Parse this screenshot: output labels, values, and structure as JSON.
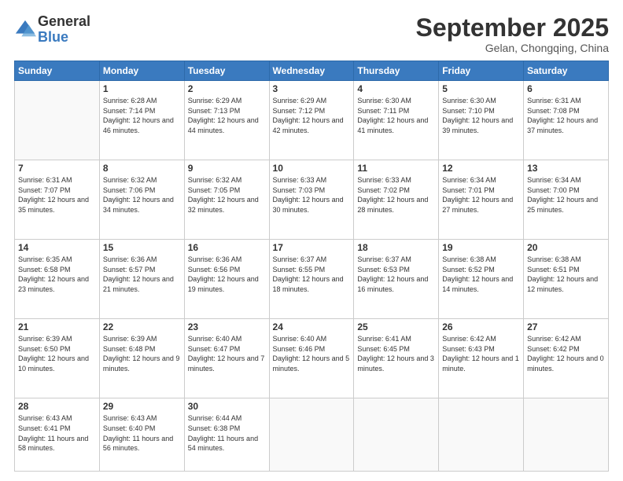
{
  "logo": {
    "general": "General",
    "blue": "Blue"
  },
  "header": {
    "month": "September 2025",
    "location": "Gelan, Chongqing, China"
  },
  "weekdays": [
    "Sunday",
    "Monday",
    "Tuesday",
    "Wednesday",
    "Thursday",
    "Friday",
    "Saturday"
  ],
  "weeks": [
    [
      {
        "day": "",
        "sunrise": "",
        "sunset": "",
        "daylight": ""
      },
      {
        "day": "1",
        "sunrise": "Sunrise: 6:28 AM",
        "sunset": "Sunset: 7:14 PM",
        "daylight": "Daylight: 12 hours and 46 minutes."
      },
      {
        "day": "2",
        "sunrise": "Sunrise: 6:29 AM",
        "sunset": "Sunset: 7:13 PM",
        "daylight": "Daylight: 12 hours and 44 minutes."
      },
      {
        "day": "3",
        "sunrise": "Sunrise: 6:29 AM",
        "sunset": "Sunset: 7:12 PM",
        "daylight": "Daylight: 12 hours and 42 minutes."
      },
      {
        "day": "4",
        "sunrise": "Sunrise: 6:30 AM",
        "sunset": "Sunset: 7:11 PM",
        "daylight": "Daylight: 12 hours and 41 minutes."
      },
      {
        "day": "5",
        "sunrise": "Sunrise: 6:30 AM",
        "sunset": "Sunset: 7:10 PM",
        "daylight": "Daylight: 12 hours and 39 minutes."
      },
      {
        "day": "6",
        "sunrise": "Sunrise: 6:31 AM",
        "sunset": "Sunset: 7:08 PM",
        "daylight": "Daylight: 12 hours and 37 minutes."
      }
    ],
    [
      {
        "day": "7",
        "sunrise": "Sunrise: 6:31 AM",
        "sunset": "Sunset: 7:07 PM",
        "daylight": "Daylight: 12 hours and 35 minutes."
      },
      {
        "day": "8",
        "sunrise": "Sunrise: 6:32 AM",
        "sunset": "Sunset: 7:06 PM",
        "daylight": "Daylight: 12 hours and 34 minutes."
      },
      {
        "day": "9",
        "sunrise": "Sunrise: 6:32 AM",
        "sunset": "Sunset: 7:05 PM",
        "daylight": "Daylight: 12 hours and 32 minutes."
      },
      {
        "day": "10",
        "sunrise": "Sunrise: 6:33 AM",
        "sunset": "Sunset: 7:03 PM",
        "daylight": "Daylight: 12 hours and 30 minutes."
      },
      {
        "day": "11",
        "sunrise": "Sunrise: 6:33 AM",
        "sunset": "Sunset: 7:02 PM",
        "daylight": "Daylight: 12 hours and 28 minutes."
      },
      {
        "day": "12",
        "sunrise": "Sunrise: 6:34 AM",
        "sunset": "Sunset: 7:01 PM",
        "daylight": "Daylight: 12 hours and 27 minutes."
      },
      {
        "day": "13",
        "sunrise": "Sunrise: 6:34 AM",
        "sunset": "Sunset: 7:00 PM",
        "daylight": "Daylight: 12 hours and 25 minutes."
      }
    ],
    [
      {
        "day": "14",
        "sunrise": "Sunrise: 6:35 AM",
        "sunset": "Sunset: 6:58 PM",
        "daylight": "Daylight: 12 hours and 23 minutes."
      },
      {
        "day": "15",
        "sunrise": "Sunrise: 6:36 AM",
        "sunset": "Sunset: 6:57 PM",
        "daylight": "Daylight: 12 hours and 21 minutes."
      },
      {
        "day": "16",
        "sunrise": "Sunrise: 6:36 AM",
        "sunset": "Sunset: 6:56 PM",
        "daylight": "Daylight: 12 hours and 19 minutes."
      },
      {
        "day": "17",
        "sunrise": "Sunrise: 6:37 AM",
        "sunset": "Sunset: 6:55 PM",
        "daylight": "Daylight: 12 hours and 18 minutes."
      },
      {
        "day": "18",
        "sunrise": "Sunrise: 6:37 AM",
        "sunset": "Sunset: 6:53 PM",
        "daylight": "Daylight: 12 hours and 16 minutes."
      },
      {
        "day": "19",
        "sunrise": "Sunrise: 6:38 AM",
        "sunset": "Sunset: 6:52 PM",
        "daylight": "Daylight: 12 hours and 14 minutes."
      },
      {
        "day": "20",
        "sunrise": "Sunrise: 6:38 AM",
        "sunset": "Sunset: 6:51 PM",
        "daylight": "Daylight: 12 hours and 12 minutes."
      }
    ],
    [
      {
        "day": "21",
        "sunrise": "Sunrise: 6:39 AM",
        "sunset": "Sunset: 6:50 PM",
        "daylight": "Daylight: 12 hours and 10 minutes."
      },
      {
        "day": "22",
        "sunrise": "Sunrise: 6:39 AM",
        "sunset": "Sunset: 6:48 PM",
        "daylight": "Daylight: 12 hours and 9 minutes."
      },
      {
        "day": "23",
        "sunrise": "Sunrise: 6:40 AM",
        "sunset": "Sunset: 6:47 PM",
        "daylight": "Daylight: 12 hours and 7 minutes."
      },
      {
        "day": "24",
        "sunrise": "Sunrise: 6:40 AM",
        "sunset": "Sunset: 6:46 PM",
        "daylight": "Daylight: 12 hours and 5 minutes."
      },
      {
        "day": "25",
        "sunrise": "Sunrise: 6:41 AM",
        "sunset": "Sunset: 6:45 PM",
        "daylight": "Daylight: 12 hours and 3 minutes."
      },
      {
        "day": "26",
        "sunrise": "Sunrise: 6:42 AM",
        "sunset": "Sunset: 6:43 PM",
        "daylight": "Daylight: 12 hours and 1 minute."
      },
      {
        "day": "27",
        "sunrise": "Sunrise: 6:42 AM",
        "sunset": "Sunset: 6:42 PM",
        "daylight": "Daylight: 12 hours and 0 minutes."
      }
    ],
    [
      {
        "day": "28",
        "sunrise": "Sunrise: 6:43 AM",
        "sunset": "Sunset: 6:41 PM",
        "daylight": "Daylight: 11 hours and 58 minutes."
      },
      {
        "day": "29",
        "sunrise": "Sunrise: 6:43 AM",
        "sunset": "Sunset: 6:40 PM",
        "daylight": "Daylight: 11 hours and 56 minutes."
      },
      {
        "day": "30",
        "sunrise": "Sunrise: 6:44 AM",
        "sunset": "Sunset: 6:38 PM",
        "daylight": "Daylight: 11 hours and 54 minutes."
      },
      {
        "day": "",
        "sunrise": "",
        "sunset": "",
        "daylight": ""
      },
      {
        "day": "",
        "sunrise": "",
        "sunset": "",
        "daylight": ""
      },
      {
        "day": "",
        "sunrise": "",
        "sunset": "",
        "daylight": ""
      },
      {
        "day": "",
        "sunrise": "",
        "sunset": "",
        "daylight": ""
      }
    ]
  ]
}
